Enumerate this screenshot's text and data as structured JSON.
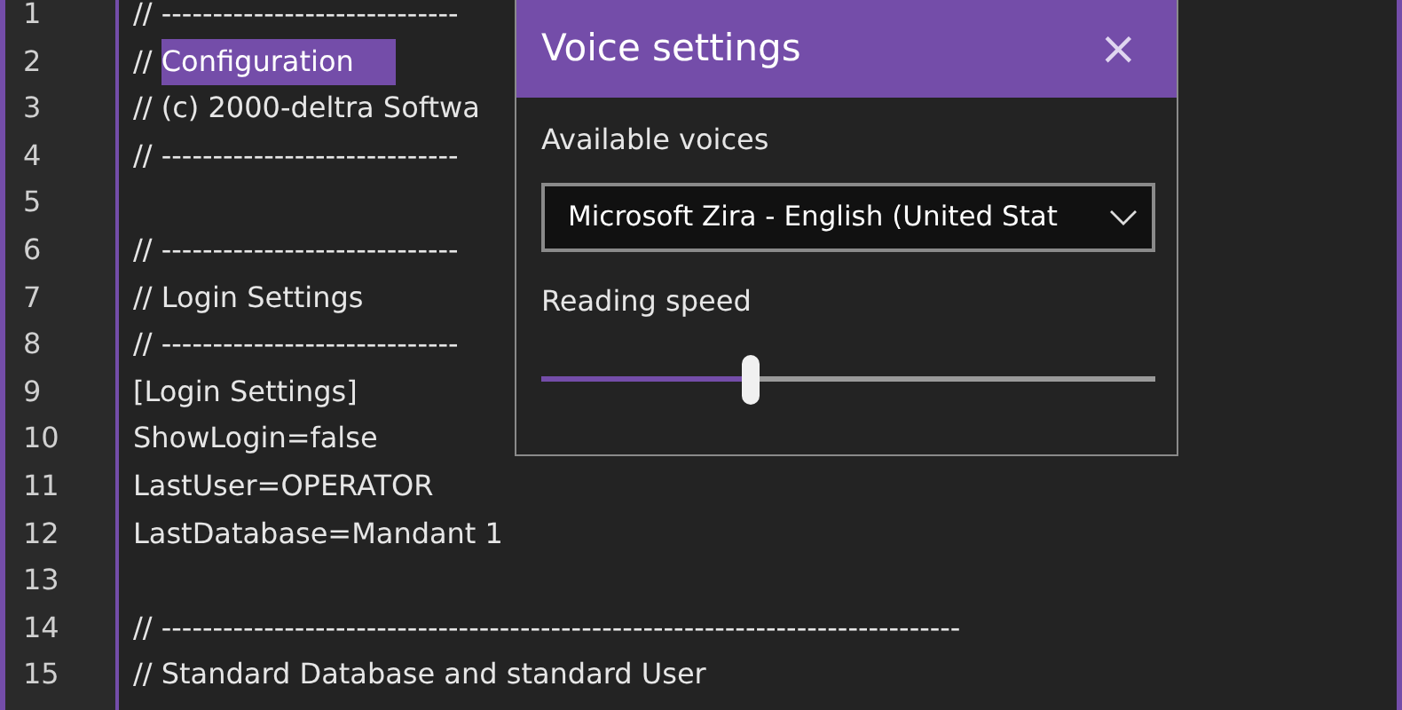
{
  "editor": {
    "lines": [
      {
        "number": "1",
        "text": "// -----------------------------"
      },
      {
        "number": "2",
        "text": "// ",
        "selection": "Configuration"
      },
      {
        "number": "3",
        "text": "// (c) 2000-deltra Softwa"
      },
      {
        "number": "4",
        "text": "// -----------------------------"
      },
      {
        "number": "5"
      },
      {
        "number": "6",
        "text": "// -----------------------------"
      },
      {
        "number": "7",
        "text": "// Login Settings"
      },
      {
        "number": "8",
        "text": "// -----------------------------"
      },
      {
        "number": "9",
        "text": "[Login Settings]"
      },
      {
        "number": "10",
        "text": "ShowLogin=false"
      },
      {
        "number": "11",
        "text": "LastUser=OPERATOR"
      },
      {
        "number": "12",
        "text": "LastDatabase=Mandant 1"
      },
      {
        "number": "13"
      },
      {
        "number": "14",
        "text": "// ------------------------------------------------------------------------------"
      },
      {
        "number": "15",
        "text": "// Standard Database and standard User"
      }
    ]
  },
  "dialog": {
    "title": "Voice settings",
    "close": "×",
    "voices_label": "Available voices",
    "voice": "Microsoft Zira - English (United Stat",
    "speed_label": "Reading speed",
    "speed": {
      "level": 0.34
    }
  }
}
